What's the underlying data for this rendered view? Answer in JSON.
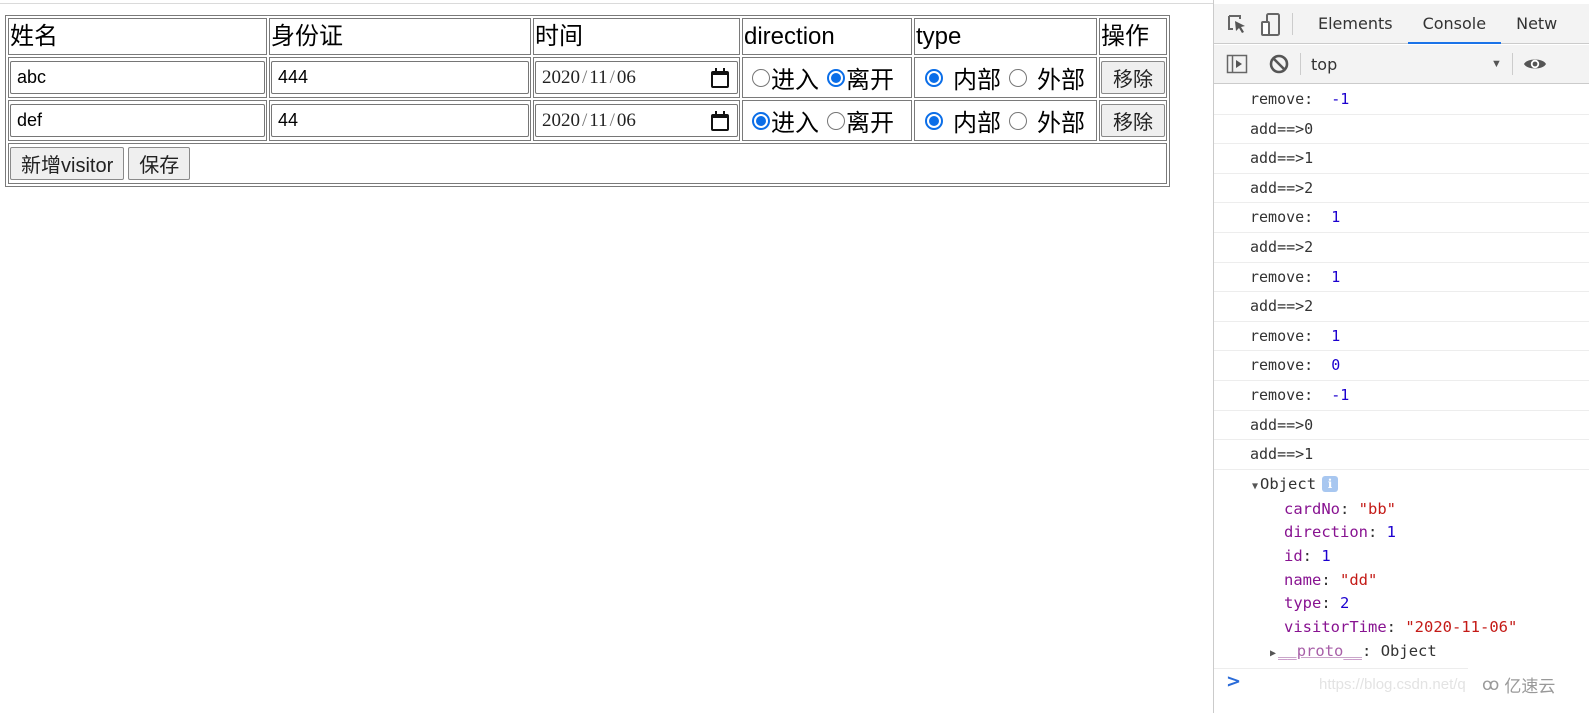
{
  "table": {
    "headers": [
      "姓名",
      "身份证",
      "时间",
      "direction",
      "type",
      "操作"
    ],
    "rows": [
      {
        "name": "abc",
        "card_no": "444",
        "date": {
          "year": "2020",
          "month": "11",
          "day": "06"
        },
        "direction": {
          "options": [
            "进入",
            "离开"
          ],
          "selected": "离开"
        },
        "type": {
          "options": [
            "内部",
            "外部"
          ],
          "selected": "内部"
        },
        "remove_label": "移除"
      },
      {
        "name": "def",
        "card_no": "44",
        "date": {
          "year": "2020",
          "month": "11",
          "day": "06"
        },
        "direction": {
          "options": [
            "进入",
            "离开"
          ],
          "selected": "进入"
        },
        "type": {
          "options": [
            "内部",
            "外部"
          ],
          "selected": "内部"
        },
        "remove_label": "移除"
      }
    ],
    "add_button_label": "新增visitor",
    "save_button_label": "保存"
  },
  "devtools": {
    "tabs": [
      "Elements",
      "Console",
      "Netw"
    ],
    "active_tab": "Console",
    "context": "top",
    "icons": [
      "inspect-element-icon",
      "device-toolbar-icon",
      "sidebar-toggle-icon",
      "clear-console-icon",
      "eye-icon"
    ],
    "logs": [
      {
        "text": "remove:  ",
        "value": "-1"
      },
      {
        "text": "add==>0",
        "value": null
      },
      {
        "text": "add==>1",
        "value": null
      },
      {
        "text": "add==>2",
        "value": null
      },
      {
        "text": "remove:  ",
        "value": "1"
      },
      {
        "text": "add==>2",
        "value": null
      },
      {
        "text": "remove:  ",
        "value": "1"
      },
      {
        "text": "add==>2",
        "value": null
      },
      {
        "text": "remove:  ",
        "value": "1"
      },
      {
        "text": "remove:  ",
        "value": "0"
      },
      {
        "text": "remove:  ",
        "value": "-1"
      },
      {
        "text": "add==>0",
        "value": null
      },
      {
        "text": "add==>1",
        "value": null
      }
    ],
    "object": {
      "label": "Object",
      "properties": [
        {
          "key": "cardNo",
          "value": "\"bb\"",
          "kind": "string"
        },
        {
          "key": "direction",
          "value": "1",
          "kind": "number"
        },
        {
          "key": "id",
          "value": "1",
          "kind": "number"
        },
        {
          "key": "name",
          "value": "\"dd\"",
          "kind": "string"
        },
        {
          "key": "type",
          "value": "2",
          "kind": "number"
        },
        {
          "key": "visitorTime",
          "value": "\"2020-11-06\"",
          "kind": "string"
        }
      ],
      "proto_key": "__proto__",
      "proto_value": "Object"
    },
    "prompt": ">"
  },
  "watermark": {
    "url_text": "https://blog.csdn.net/q",
    "brand_text": "亿速云"
  },
  "colors": {
    "radio_checked": "#0b6ee8",
    "active_tab_underline": "#1a73e8",
    "console_number": "#1c00cf",
    "console_key": "#881391",
    "console_string": "#c41a16"
  }
}
